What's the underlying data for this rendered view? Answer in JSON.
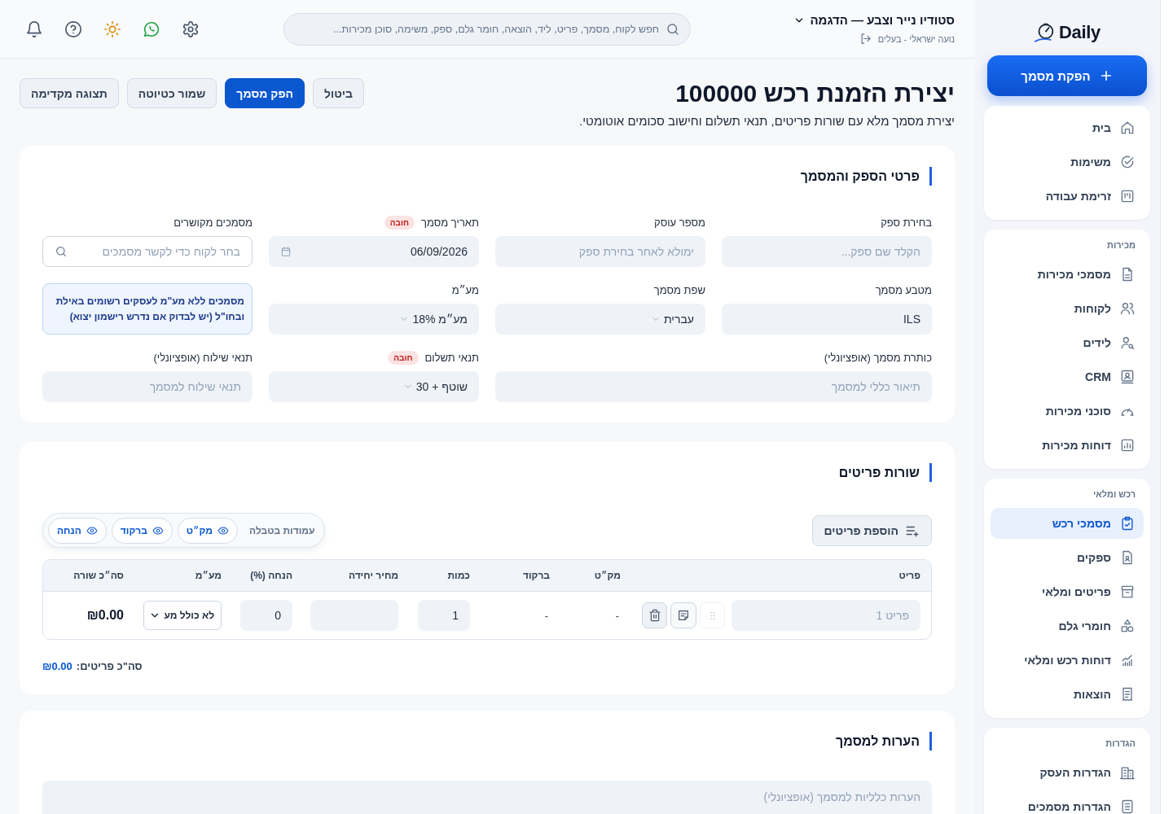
{
  "topbar": {
    "workspace": "סטודיו נייר וצבע — הדגמה",
    "user": "נועה ישראלי - בעלים",
    "search": {
      "placeholder": "חפש לקוח, מסמך, פריט, ליד, הוצאה, חומר גלם, ספק, משימה, סוכן מכירות..."
    }
  },
  "header": {
    "title": "יצירת הזמנת רכש 100000",
    "subtitle": "יצירת מסמך מלא עם שורות פריטים, תנאי תשלום וחישוב סכומים אוטומטי.",
    "actions": [
      {
        "label": "ביטול",
        "kind": "secondary"
      },
      {
        "label": "הפק מסמך",
        "kind": "primary"
      },
      {
        "label": "שמור כטיוטה",
        "kind": "secondary"
      },
      {
        "label": "תצוגה מקדימה",
        "kind": "secondary"
      }
    ]
  },
  "details": {
    "title": "פרטי הספק והמסמך",
    "fields": [
      {
        "kind": "text",
        "label": "בחירת ספק",
        "placeholder": "הקלד שם ספק..."
      },
      {
        "kind": "text",
        "label": "מספר עוסק",
        "placeholder": "ימולא לאחר בחירת ספק"
      },
      {
        "kind": "date",
        "label": "תאריך מסמך",
        "badge": "חובה",
        "value": "06/09/2026"
      },
      {
        "kind": "search",
        "label": "מסמכים מקושרים",
        "placeholder": "בחר לקוח כדי לקשר מסמכים"
      },
      {
        "kind": "text",
        "label": "מטבע מסמך",
        "value": "ILS"
      },
      {
        "kind": "select",
        "label": "שפת מסמך",
        "value": "עברית"
      },
      {
        "kind": "select",
        "label": "מע״מ",
        "value": "מע״מ 18%"
      },
      {
        "kind": "note",
        "text": "מסמכים ללא מע\"מ לעסקים רשומים באילת ובחו\"ל (יש לבדוק אם נדרש רישמון יצוא)"
      },
      {
        "kind": "wide-text",
        "label": "כותרת מסמך (אופציונלי)",
        "placeholder": "תיאור כללי למסמך"
      },
      {
        "kind": "select",
        "label": "תנאי תשלום",
        "badge": "חובה",
        "value": "שוטף + 30"
      },
      {
        "kind": "text",
        "label": "תנאי שילוח (אופציונלי)",
        "placeholder": "תנאי שילוח למסמך"
      }
    ]
  },
  "items": {
    "title": "שורות פריטים",
    "add_button": "הוספת פריטים",
    "column_toggles": {
      "label": "עמודות בטבלה",
      "chips": [
        {
          "label": "מק״ט",
          "on": true
        },
        {
          "label": "ברקוד",
          "on": true
        },
        {
          "label": "הנחה",
          "on": true
        }
      ]
    },
    "table": {
      "columns": [
        "פריט",
        "מק״ט",
        "ברקוד",
        "כמות",
        "מחיר יחידה",
        "הנחה (%)",
        "מע״מ",
        "סה״כ שורה"
      ],
      "rows": [
        {
          "item": {
            "placeholder": "פריט 1"
          },
          "sku": "-",
          "barcode": "-",
          "quantity": "1",
          "discount": "0",
          "vat": "לא כולל מע",
          "total": "₪0.00"
        }
      ]
    },
    "total": {
      "label": "סה\"כ פריטים:",
      "value": "₪0.00"
    }
  },
  "notes": {
    "title": "הערות למסמך",
    "placeholder": "הערות כלליות למסמך (אופציונלי)"
  },
  "sidebar": {
    "logo": "Daily",
    "new_document": "הפקת מסמך",
    "groups": [
      {
        "items": [
          {
            "label": "בית",
            "selected": false
          },
          {
            "label": "משימות",
            "selected": false
          },
          {
            "label": "זרימת עבודה",
            "selected": false
          }
        ]
      },
      {
        "title": "מכירות",
        "items": [
          {
            "label": "מסמכי מכירות",
            "selected": false
          },
          {
            "label": "לקוחות",
            "selected": false
          },
          {
            "label": "לידים",
            "selected": false
          },
          {
            "label": "CRM",
            "selected": false
          },
          {
            "label": "סוכני מכירות",
            "selected": false
          },
          {
            "label": "דוחות מכירות",
            "selected": false
          }
        ]
      },
      {
        "title": "רכש ומלאי",
        "items": [
          {
            "label": "מסמכי רכש",
            "selected": true
          },
          {
            "label": "ספקים",
            "selected": false
          },
          {
            "label": "פריטים ומלאי",
            "selected": false
          },
          {
            "label": "חומרי גלם",
            "selected": false
          },
          {
            "label": "דוחות רכש ומלאי",
            "selected": false
          },
          {
            "label": "הוצאות",
            "selected": false
          }
        ]
      },
      {
        "title": "הגדרות",
        "items": [
          {
            "label": "הגדרות העסק",
            "selected": false
          },
          {
            "label": "הגדרות מסמכים",
            "selected": false
          }
        ]
      }
    ]
  }
}
